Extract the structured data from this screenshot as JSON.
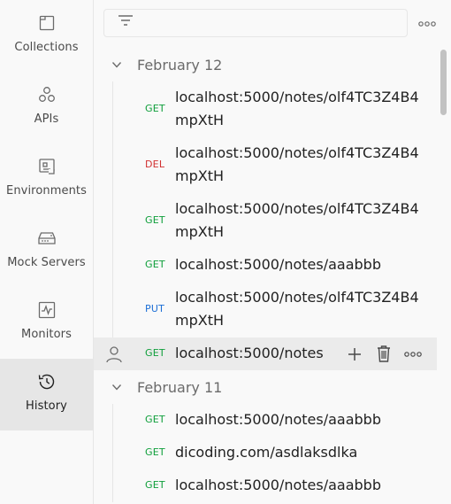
{
  "sidebar": {
    "items": [
      {
        "label": "Collections",
        "icon": "collections-icon"
      },
      {
        "label": "APIs",
        "icon": "apis-icon"
      },
      {
        "label": "Environments",
        "icon": "environments-icon"
      },
      {
        "label": "Mock Servers",
        "icon": "mock-servers-icon"
      },
      {
        "label": "Monitors",
        "icon": "monitors-icon"
      },
      {
        "label": "History",
        "icon": "history-icon",
        "active": true
      }
    ]
  },
  "toolbar": {
    "filter_placeholder": "",
    "filter_icon": "filter-icon",
    "more_icon": "more-icon"
  },
  "history": {
    "groups": [
      {
        "title": "February 12",
        "requests": [
          {
            "method": "GET",
            "url": "localhost:5000/notes/olf4TC3Z4B4mpXtH"
          },
          {
            "method": "DEL",
            "url": "localhost:5000/notes/olf4TC3Z4B4mpXtH"
          },
          {
            "method": "GET",
            "url": "localhost:5000/notes/olf4TC3Z4B4mpXtH"
          },
          {
            "method": "GET",
            "url": "localhost:5000/notes/aaabbb"
          },
          {
            "method": "PUT",
            "url": "localhost:5000/notes/olf4TC3Z4B4mpXtH"
          },
          {
            "method": "GET",
            "url": "localhost:5000/notes"
          }
        ]
      },
      {
        "title": "February 11",
        "requests": [
          {
            "method": "GET",
            "url": "localhost:5000/notes/aaabbb"
          },
          {
            "method": "GET",
            "url": "dicoding.com/asdlaksdlka"
          },
          {
            "method": "GET",
            "url": "localhost:5000/notes/aaabbb"
          }
        ]
      }
    ]
  },
  "colors": {
    "get": "#0e9e3a",
    "del": "#d12f2f",
    "put": "#1d6fd6",
    "active_nav_bg": "#e6e6e6",
    "hover_row_bg": "#ebebeb"
  }
}
